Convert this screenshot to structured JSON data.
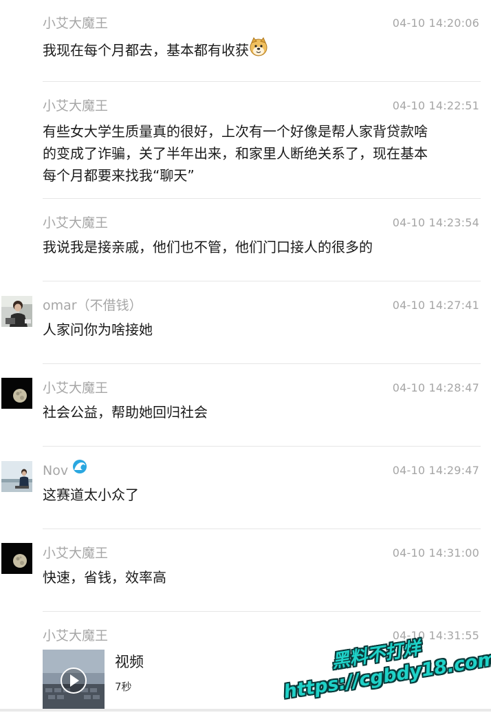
{
  "messages": [
    {
      "sender": "小艾大魔王",
      "time": "04-10 14:20:06",
      "text": "我现在每个月都去，基本都有收获",
      "emoji": "doge-emoji"
    },
    {
      "sender": "小艾大魔王",
      "time": "04-10 14:22:51",
      "lines": [
        "有些女大学生质量真的很好，上次有一个好像是帮人家背贷款啥",
        "的变成了诈骗，关了半年出来，和家里人断绝关系了，现在基本",
        "每个月都要来找我“聊天”"
      ]
    },
    {
      "sender": "小艾大魔王",
      "time": "04-10 14:23:54",
      "text": "我说我是接亲戚，他们也不管，他们门口接人的很多的"
    },
    {
      "sender": "omar（不借钱）",
      "time": "04-10 14:27:41",
      "text": "人家问你为啥接她",
      "avatar": "man-photo-avatar"
    },
    {
      "sender": "小艾大魔王",
      "time": "04-10 14:28:47",
      "text": "社会公益，帮助她回归社会",
      "avatar": "moon-avatar"
    },
    {
      "sender": "Nov",
      "time": "04-10 14:29:47",
      "text": "这赛道太小众了",
      "avatar": "person-photo-avatar",
      "badge": "wave-badge-icon"
    },
    {
      "sender": "小艾大魔王",
      "time": "04-10 14:31:00",
      "text": "快速，省钱，效率高",
      "avatar": "moon-avatar"
    },
    {
      "sender": "小艾大魔王",
      "time": "04-10 14:31:55",
      "video": {
        "title": "视频",
        "duration": "7秒"
      }
    }
  ],
  "watermark": {
    "line1": "黑料不打烊",
    "line2": "https://cgbdy18.com"
  },
  "colors": {
    "meta": "#a6a6a6",
    "text": "#1a1a1a",
    "divider": "#e6e6e6",
    "watermark": "#1fd2c8"
  }
}
